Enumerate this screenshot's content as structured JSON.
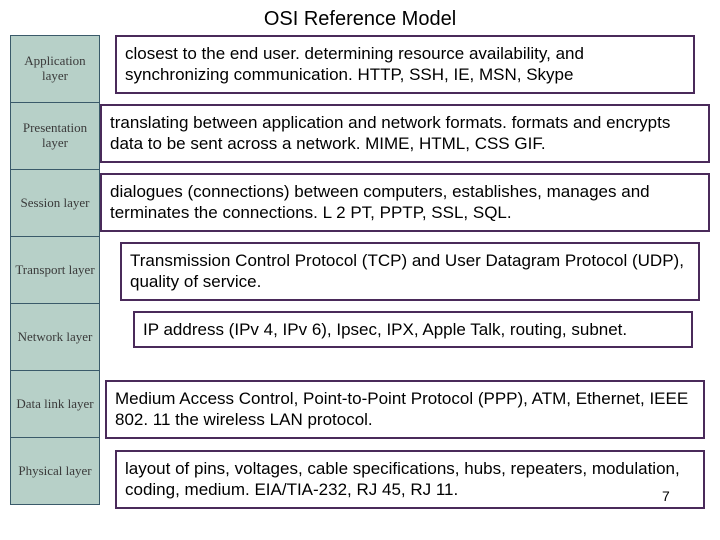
{
  "title": "OSI Reference Model",
  "page_number": "7",
  "layers": [
    {
      "name": "Application layer"
    },
    {
      "name": "Presentation layer"
    },
    {
      "name": "Session layer"
    },
    {
      "name": "Transport layer"
    },
    {
      "name": "Network layer"
    },
    {
      "name": "Data link layer"
    },
    {
      "name": "Physical layer"
    }
  ],
  "descriptions": [
    {
      "text": "closest to the end user. determining resource availability, and synchronizing communication. HTTP, SSH, IE, MSN, Skype"
    },
    {
      "text": "translating between application and network formats. formats and encrypts data to be sent across a network. MIME, HTML, CSS GIF."
    },
    {
      "text": "dialogues (connections) between computers, establishes, manages and terminates the connections. L 2 PT, PPTP, SSL, SQL."
    },
    {
      "text": "Transmission Control Protocol (TCP) and User Datagram Protocol (UDP), quality of service."
    },
    {
      "text": "IP address (IPv 4, IPv 6), Ipsec, IPX, Apple Talk, routing, subnet."
    },
    {
      "text": "Medium Access Control, Point-to-Point Protocol (PPP), ATM, Ethernet, IEEE 802. 11 the wireless LAN protocol."
    },
    {
      "text": "layout of pins, voltages, cable specifications, hubs, repeaters, modulation, coding, medium. EIA/TIA-232, RJ 45, RJ 11."
    }
  ]
}
